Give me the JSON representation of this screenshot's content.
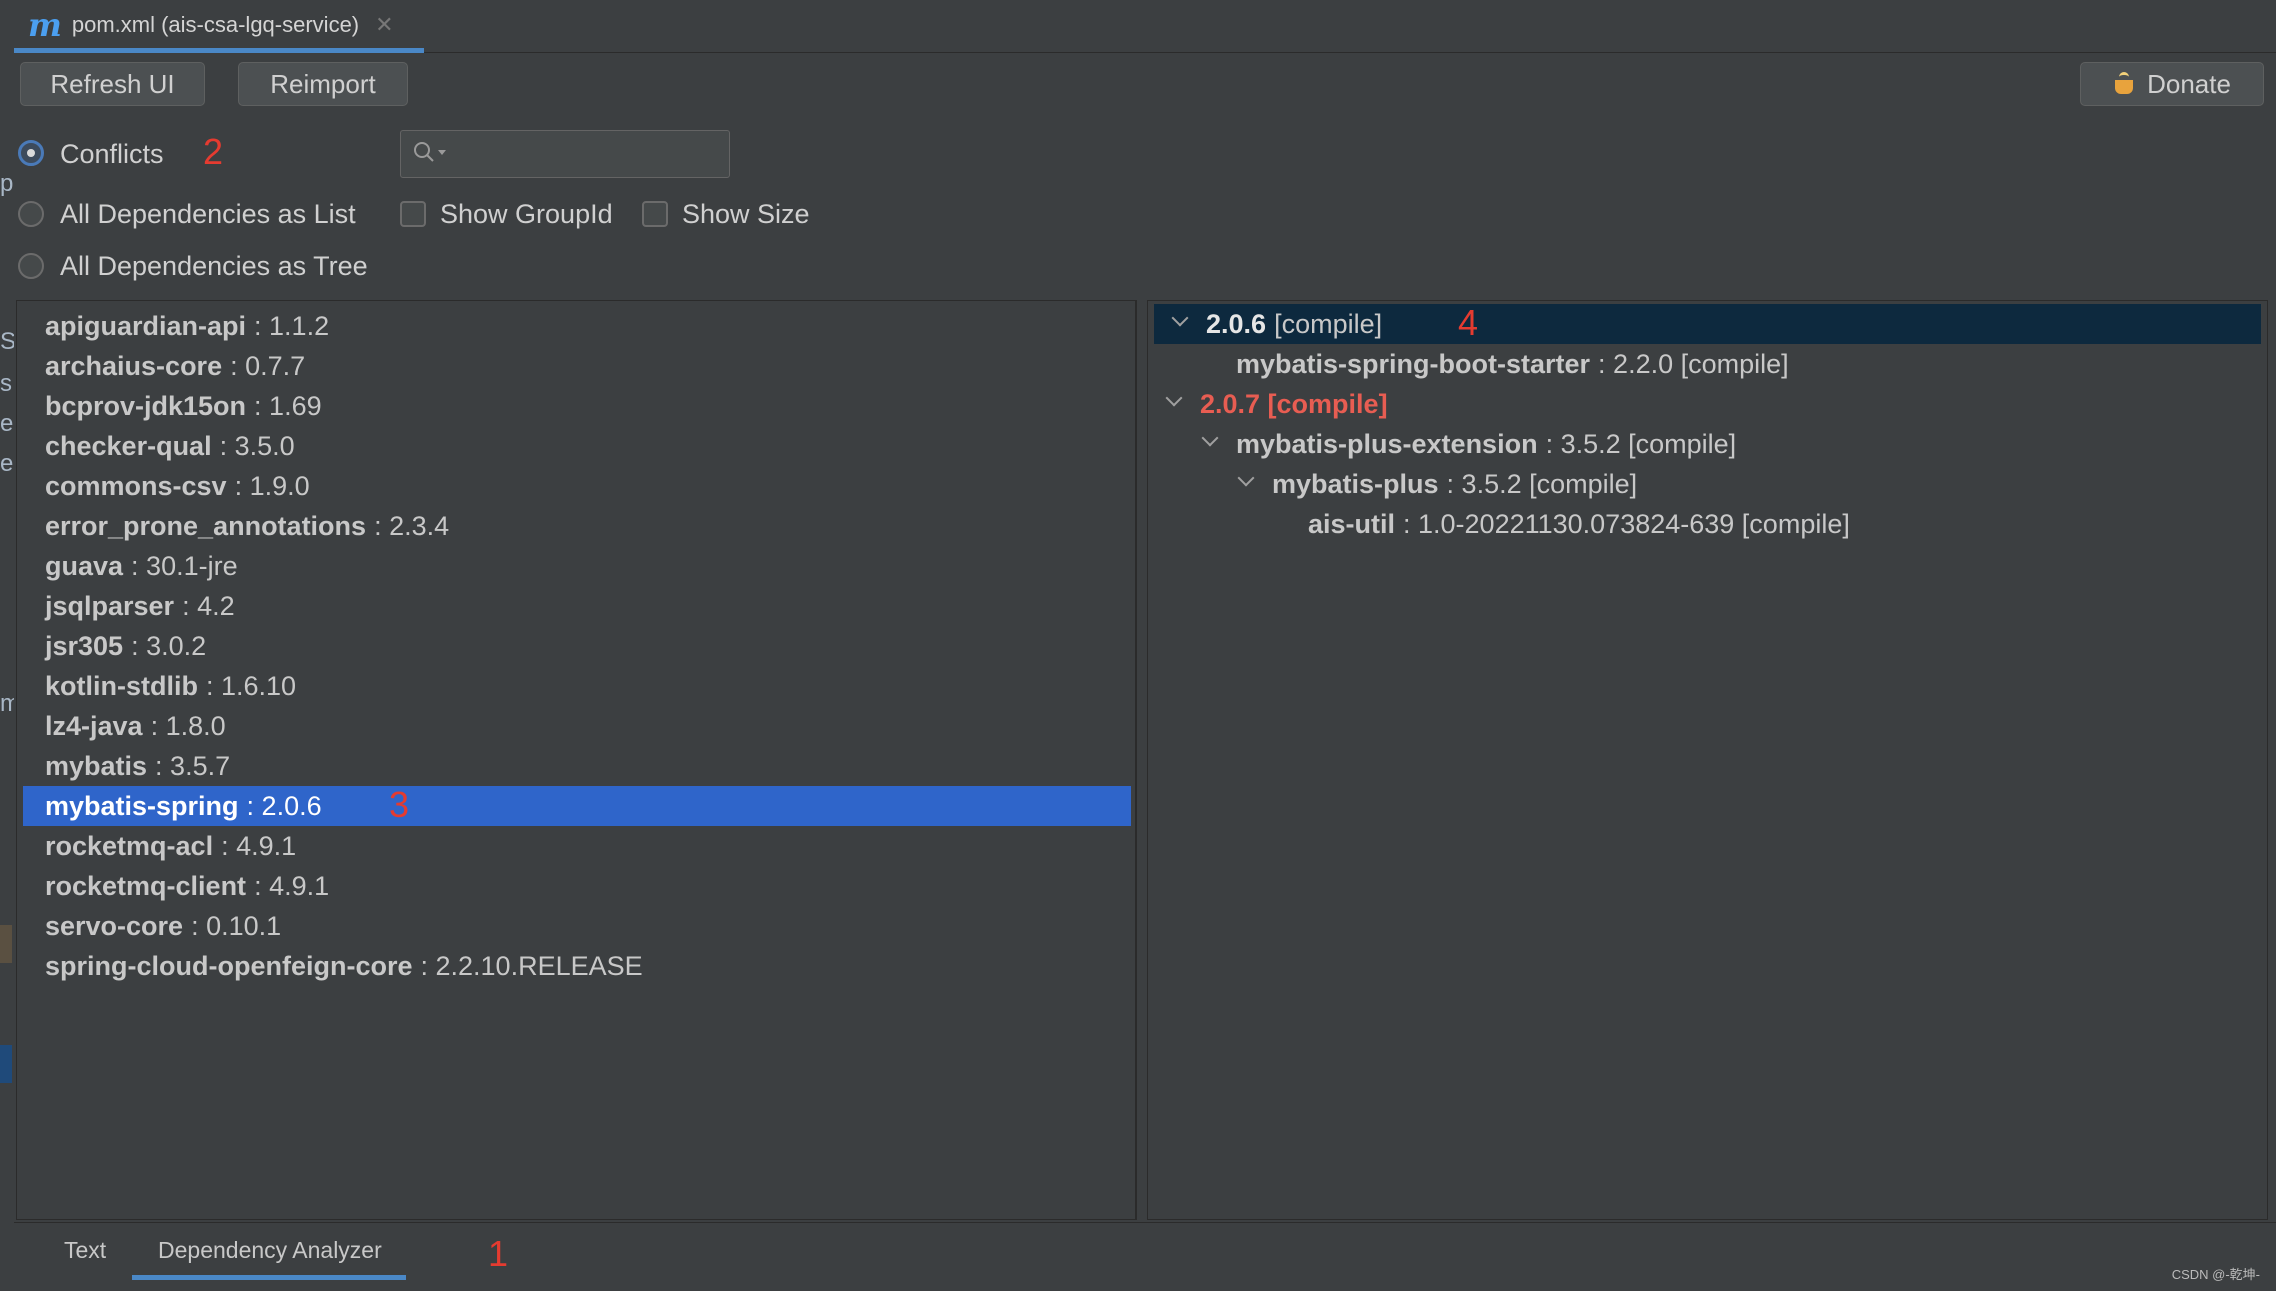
{
  "gutter_chars": [
    "p",
    "S",
    "s",
    "e",
    "e",
    "m"
  ],
  "editor_tab": {
    "icon": "m",
    "title": "pom.xml (ais-csa-lgq-service)",
    "close": "✕"
  },
  "toolbar": {
    "refresh_label": "Refresh UI",
    "reimport_label": "Reimport",
    "donate_label": "Donate"
  },
  "view_mode": {
    "options": [
      "Conflicts",
      "All Dependencies as List",
      "All Dependencies as Tree"
    ],
    "selected": "Conflicts"
  },
  "search": {
    "placeholder": "",
    "value": ""
  },
  "checkboxes": {
    "show_groupid": "Show GroupId",
    "show_size": "Show Size"
  },
  "annotations": [
    "1",
    "2",
    "3",
    "4"
  ],
  "dependency_list": [
    {
      "name": "apiguardian-api",
      "version": ": 1.1.2"
    },
    {
      "name": "archaius-core",
      "version": ": 0.7.7"
    },
    {
      "name": "bcprov-jdk15on",
      "version": ": 1.69"
    },
    {
      "name": "checker-qual",
      "version": ": 3.5.0"
    },
    {
      "name": "commons-csv",
      "version": ": 1.9.0"
    },
    {
      "name": "error_prone_annotations",
      "version": ": 2.3.4"
    },
    {
      "name": "guava",
      "version": ": 30.1-jre"
    },
    {
      "name": "jsqlparser",
      "version": ": 4.2"
    },
    {
      "name": "jsr305",
      "version": ": 3.0.2"
    },
    {
      "name": "kotlin-stdlib",
      "version": ": 1.6.10"
    },
    {
      "name": "lz4-java",
      "version": ": 1.8.0"
    },
    {
      "name": "mybatis",
      "version": ": 3.5.7"
    },
    {
      "name": "mybatis-spring",
      "version": ": 2.0.6"
    },
    {
      "name": "rocketmq-acl",
      "version": ": 4.9.1"
    },
    {
      "name": "rocketmq-client",
      "version": ": 4.9.1"
    },
    {
      "name": "servo-core",
      "version": ": 0.10.1"
    },
    {
      "name": "spring-cloud-openfeign-core",
      "version": ": 2.2.10.RELEASE"
    }
  ],
  "selected_dependency": "mybatis-spring",
  "usage_tree": [
    {
      "name": "2.0.6",
      "version": "[compile]"
    },
    {
      "name": "mybatis-spring-boot-starter",
      "version": ": 2.2.0 [compile]"
    },
    {
      "name": "2.0.7 [compile]",
      "version": ""
    },
    {
      "name": "mybatis-plus-extension",
      "version": ": 3.5.2 [compile]"
    },
    {
      "name": "mybatis-plus",
      "version": ": 3.5.2 [compile]"
    },
    {
      "name": "ais-util",
      "version": ": 1.0-20221130.073824-639 [compile]"
    }
  ],
  "bottom_tabs": {
    "text": "Text",
    "analyzer": "Dependency Analyzer"
  },
  "watermark": "CSDN @-乾坤-",
  "colors": {
    "accent": "#4a88c7",
    "selection": "#2f65ca",
    "conflict": "#e85d52",
    "annotation": "#e53b30"
  }
}
